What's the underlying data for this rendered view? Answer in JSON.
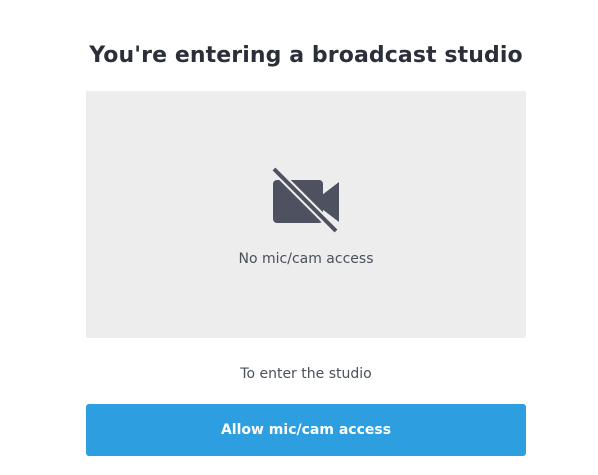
{
  "dialog": {
    "title": "You're entering a broadcast studio",
    "preview": {
      "icon": "camera-off-icon",
      "status_text": "No mic/cam access",
      "background_color": "#ededed",
      "icon_color": "#4e5160"
    },
    "instruction_text": "To enter the studio",
    "allow_button": {
      "label": "Allow mic/cam access",
      "color": "#2d9fe0"
    }
  }
}
